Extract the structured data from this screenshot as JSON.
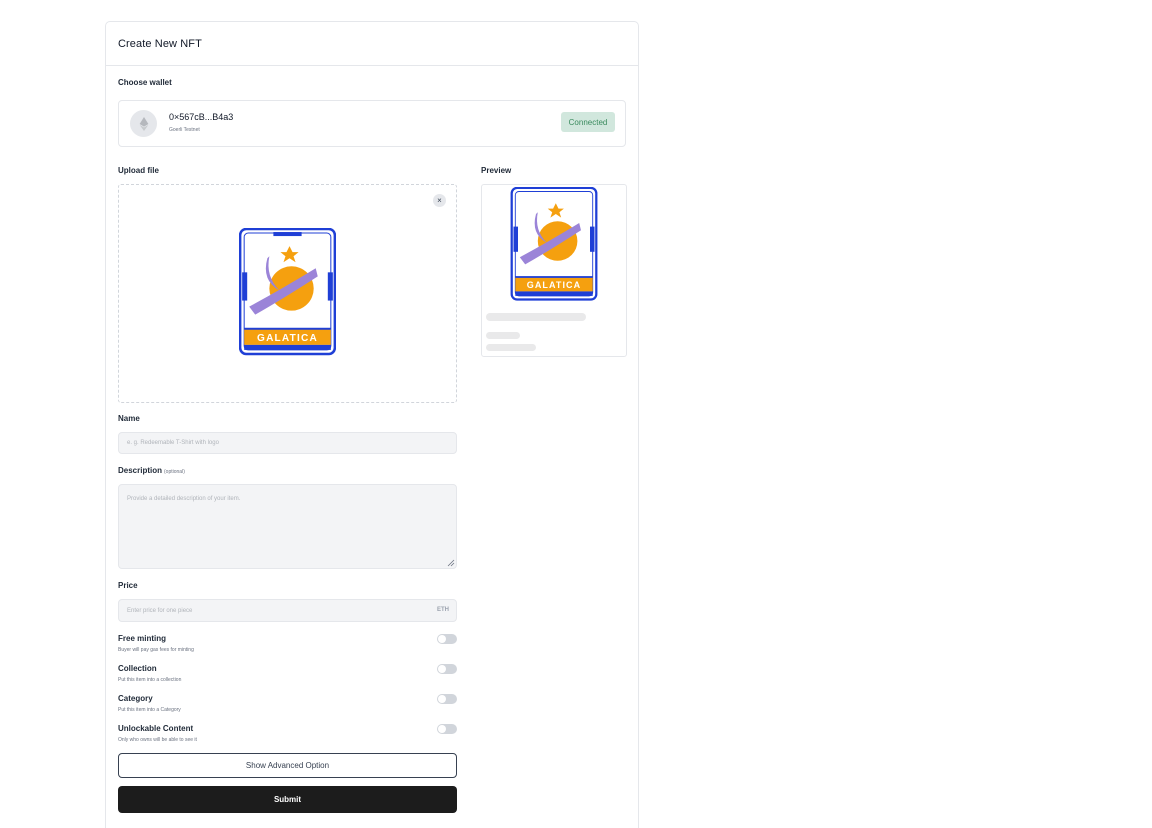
{
  "header": {
    "title": "Create New NFT"
  },
  "wallet": {
    "section_label": "Choose wallet",
    "icon": "ethereum-icon",
    "address": "0×567cB...B4a3",
    "network": "Goerli Testnet",
    "status": "Connected"
  },
  "upload": {
    "label": "Upload file",
    "remove_label": "×",
    "image_text": "GALATICA"
  },
  "preview": {
    "label": "Preview",
    "image_text": "GALATICA"
  },
  "form": {
    "name": {
      "label": "Name",
      "placeholder": "e. g. Redeemable T-Shirt with logo"
    },
    "description": {
      "label": "Description",
      "optional": "(optional)",
      "placeholder": "Provide a detailed description of your item."
    },
    "price": {
      "label": "Price",
      "placeholder": "Enter price for one piece",
      "suffix": "ETH"
    }
  },
  "toggles": [
    {
      "title": "Free minting",
      "subtitle": "Buyer will pay gas fees for minting",
      "on": false
    },
    {
      "title": "Collection",
      "subtitle": "Put this item into a collection",
      "on": false
    },
    {
      "title": "Category",
      "subtitle": "Put this item into a Category",
      "on": false
    },
    {
      "title": "Unlockable Content",
      "subtitle": "Only who owns will be able to see it",
      "on": false
    }
  ],
  "actions": {
    "advanced_label": "Show Advanced Option",
    "submit_label": "Submit"
  },
  "colors": {
    "card_blue": "#1f3fd6",
    "card_orange": "#f5a00f",
    "ring_purple": "#9b84d8",
    "badge_bg": "#d1e7dd",
    "badge_text": "#3a8b5e",
    "submit_bg": "#1c1c1c"
  }
}
